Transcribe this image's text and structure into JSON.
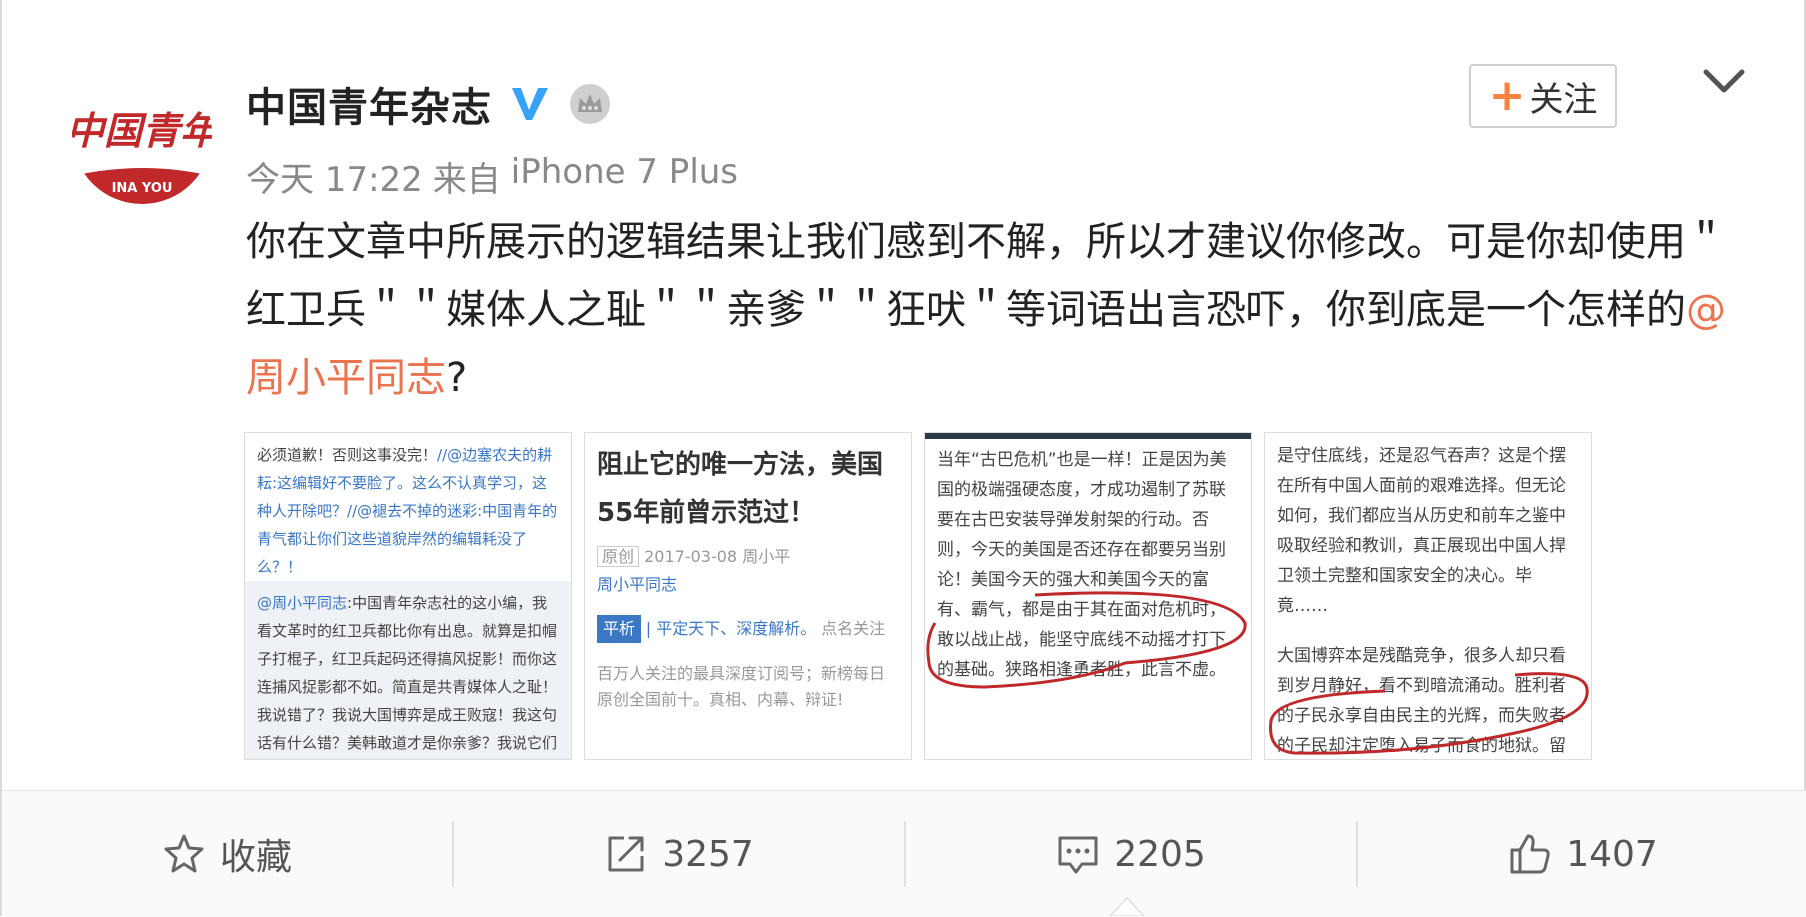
{
  "account": {
    "name": "中国青年杂志",
    "verified_icon": "verified-v-icon",
    "member_icon": "crown-icon",
    "avatar_text": "中国青年",
    "avatar_sub": "INA YOU"
  },
  "meta": {
    "time": "今天 17:22",
    "source_prefix": "来自",
    "source": "iPhone 7 Plus"
  },
  "follow_button": {
    "plus": "+",
    "label": "关注"
  },
  "post": {
    "text_main": "你在文章中所展示的逻辑结果让我们感到不解，所以才建议你修改。可是你却使用＂红卫兵＂＂媒体人之耻＂＂亲爹＂＂狂吠＂等词语出言恐吓，你到底是一个怎样的",
    "mention": "@周小平同志",
    "text_end": "?"
  },
  "thumbnails": {
    "t1": {
      "p1": "必须道歉！否则这事没完！",
      "p1b": "//@边塞农夫的耕耘:这编辑好不要脸了。这么不认真学习，这种人开除吧？",
      "p1c": "//@褪去不掉的迷彩:中国青年的青气都让你们这些道貌岸然的编辑耗没了么？！",
      "p2a": "@周小平同志",
      "p2": ":中国青年杂志社的这小编，我看文革时的红卫兵都比你有出息。就算是扣帽子打棍子，红卫兵起码还得搞风捉影！而你这连捕风捉影都不如。简直是共青媒体人之耻！我说错了？我说大国博弈是成王败寇！我这句话有什么错？美韩敢道才是你亲爹？我说它们半句不是，就气得你如此狂吠?"
    },
    "t2": {
      "title": "阻止它的唯一方法，美国55年前曾示范过！",
      "original": "原创",
      "date": "2017-03-08",
      "author": "周小平",
      "author_link": "周小平同志",
      "tag": "平析",
      "tag_desc": "| 平定天下、深度解析。",
      "follow_hint": "点名关注",
      "footer": "百万人关注的最具深度订阅号；新榜每日原创全国前十。真相、内幕、辩证!"
    },
    "t3": {
      "text": "当年“古巴危机”也是一样！正是因为美国的极端强硬态度，才成功遏制了苏联要在古巴安装导弹发射架的行动。否则，今天的美国是否还存在都要另当别论！美国今天的强大和美国今天的富有、霸气，都是由于其在面对危机时，敢以战止战，能坚守底线不动摇才打下的基础。狭路相逢勇者胜，此言不虚。"
    },
    "t4": {
      "text1": "是守住底线，还是忍气吞声？这是个摆在所有中国人面前的艰难选择。但无论如何，我们都应当从历史和前车之鉴中吸取经验和教训，真正展现出中国人捍卫领土完整和国家安全的决心。毕竟……",
      "text2": "大国博弈本是残酷竞争，很多人却只看到岁月静好，看不到暗流涌动。胜利者的子民永享自由民主的光辉，而失败者的子民却注定堕入易子而食的地狱。留"
    }
  },
  "actions": {
    "favorite": {
      "icon": "star-icon",
      "label": "收藏"
    },
    "repost": {
      "icon": "share-icon",
      "count": "3257"
    },
    "comment": {
      "icon": "comment-icon",
      "count": "2205"
    },
    "like": {
      "icon": "thumbs-up-icon",
      "count": "1407"
    }
  },
  "colors": {
    "mention": "#eb7350",
    "follow_plus": "#ff8140",
    "verified": "#36a3f7",
    "avatar_red": "#c0282a"
  }
}
